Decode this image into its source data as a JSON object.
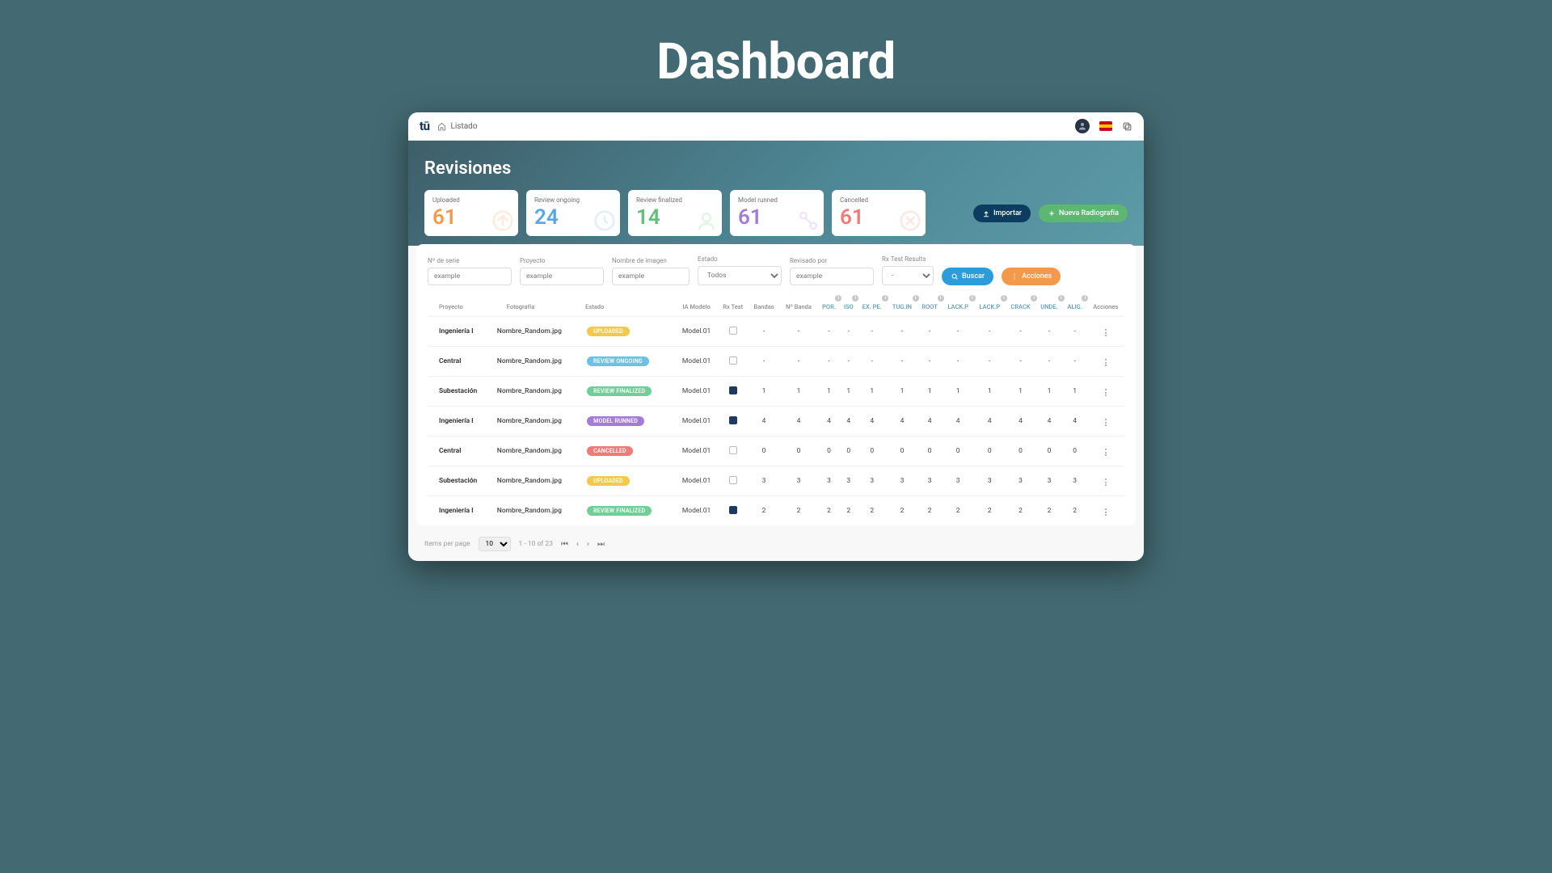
{
  "headline": "Dashboard",
  "topbar": {
    "breadcrumb": "Listado"
  },
  "hero": {
    "title": "Revisiones"
  },
  "stats": [
    {
      "label": "Uploaded",
      "value": "61",
      "color": "#f2994a"
    },
    {
      "label": "Review ongoing",
      "value": "24",
      "color": "#5aa7e8"
    },
    {
      "label": "Review finalized",
      "value": "14",
      "color": "#63c07b"
    },
    {
      "label": "Model runned",
      "value": "61",
      "color": "#a47bd6"
    },
    {
      "label": "Cancelled",
      "value": "61",
      "color": "#ef7b78"
    }
  ],
  "buttons": {
    "import": "Importar",
    "new": "Nueva Radiografía",
    "search": "Buscar",
    "actions": "Acciones"
  },
  "filters": {
    "serie": {
      "label": "Nº de serie",
      "value": "example"
    },
    "proyecto": {
      "label": "Proyecto",
      "value": "example"
    },
    "imagen": {
      "label": "Nombre de imagen",
      "value": "example"
    },
    "estado": {
      "label": "Estado",
      "value": "Todos"
    },
    "revisado": {
      "label": "Revisado por",
      "value": "example"
    },
    "rx": {
      "label": "Rx Test Results",
      "value": "-"
    }
  },
  "columns": {
    "proyecto": "Proyecto",
    "fotografia": "Fotografía",
    "estado": "Estado",
    "iamodelo": "IA Modelo",
    "rxtest": "Rx Test",
    "bandas": "Bandas",
    "nbanda": "Nº Banda",
    "defects": [
      "POR.",
      "ISO",
      "EX. PE.",
      "TUG.IN",
      "ROOT",
      "LACK.P",
      "LACK.P",
      "CRACK",
      "UNDE.",
      "ALIG."
    ],
    "acciones": "Acciones"
  },
  "rows": [
    {
      "proyecto": "Ingeniería I",
      "foto": "Nombre_Random.jpg",
      "badge": "UPLOADED",
      "badgeClass": "b-uploaded",
      "modelo": "Model.01",
      "rx": "off",
      "vals": [
        "-",
        "-",
        "-",
        "-",
        "-",
        "-",
        "-",
        "-",
        "-",
        "-",
        "-",
        "-"
      ]
    },
    {
      "proyecto": "Central",
      "foto": "Nombre_Random.jpg",
      "badge": "REVIEW ONGOING",
      "badgeClass": "b-ongoing",
      "modelo": "Model.01",
      "rx": "off",
      "vals": [
        "-",
        "-",
        "-",
        "-",
        "-",
        "-",
        "-",
        "-",
        "-",
        "-",
        "-",
        "-"
      ]
    },
    {
      "proyecto": "Subestación",
      "foto": "Nombre_Random.jpg",
      "badge": "REVIEW FINALIZED",
      "badgeClass": "b-finalized",
      "modelo": "Model.01",
      "rx": "on",
      "vals": [
        "1",
        "1",
        "1",
        "1",
        "1",
        "1",
        "1",
        "1",
        "1",
        "1",
        "1",
        "1"
      ]
    },
    {
      "proyecto": "Ingeniería I",
      "foto": "Nombre_Random.jpg",
      "badge": "MODEL RUNNED",
      "badgeClass": "b-runned",
      "modelo": "Model.01",
      "rx": "on",
      "vals": [
        "4",
        "4",
        "4",
        "4",
        "4",
        "4",
        "4",
        "4",
        "4",
        "4",
        "4",
        "4"
      ]
    },
    {
      "proyecto": "Central",
      "foto": "Nombre_Random.jpg",
      "badge": "CANCELLED",
      "badgeClass": "b-cancelled",
      "modelo": "Model.01",
      "rx": "off",
      "vals": [
        "0",
        "0",
        "0",
        "0",
        "0",
        "0",
        "0",
        "0",
        "0",
        "0",
        "0",
        "0"
      ]
    },
    {
      "proyecto": "Subestación",
      "foto": "Nombre_Random.jpg",
      "badge": "UPLOADED",
      "badgeClass": "b-uploaded",
      "modelo": "Model.01",
      "rx": "off",
      "vals": [
        "3",
        "3",
        "3",
        "3",
        "3",
        "3",
        "3",
        "3",
        "3",
        "3",
        "3",
        "3"
      ]
    },
    {
      "proyecto": "Ingeniería I",
      "foto": "Nombre_Random.jpg",
      "badge": "REVIEW FINALIZED",
      "badgeClass": "b-finalized",
      "modelo": "Model.01",
      "rx": "on",
      "vals": [
        "2",
        "2",
        "2",
        "2",
        "2",
        "2",
        "2",
        "2",
        "2",
        "2",
        "2",
        "2"
      ]
    }
  ],
  "pager": {
    "label": "Items per page",
    "perPage": "10",
    "range": "1 - 10 of 23"
  }
}
